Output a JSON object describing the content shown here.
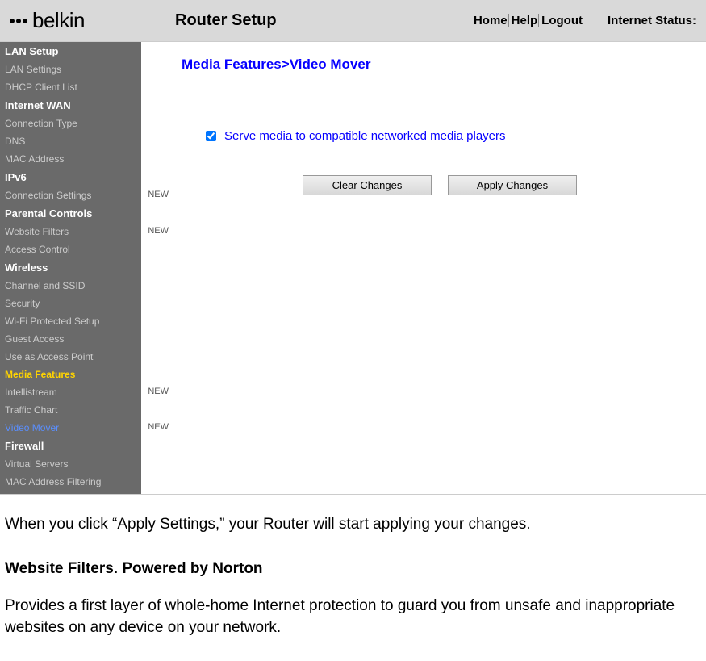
{
  "header": {
    "logo_text": "belkin",
    "title": "Router Setup",
    "links": {
      "home": "Home",
      "help": "Help",
      "logout": "Logout"
    },
    "internet_status_label": "Internet Status:"
  },
  "sidebar": {
    "items": [
      {
        "label": "LAN Setup",
        "type": "section"
      },
      {
        "label": "LAN Settings",
        "type": "sub"
      },
      {
        "label": "DHCP Client List",
        "type": "sub"
      },
      {
        "label": "Internet WAN",
        "type": "section"
      },
      {
        "label": "Connection Type",
        "type": "sub"
      },
      {
        "label": "DNS",
        "type": "sub"
      },
      {
        "label": "MAC Address",
        "type": "sub"
      },
      {
        "label": "IPv6",
        "type": "section"
      },
      {
        "label": "Connection Settings",
        "type": "sub",
        "new": "NEW"
      },
      {
        "label": "Parental Controls",
        "type": "section"
      },
      {
        "label": "Website Filters",
        "type": "sub",
        "new": "NEW"
      },
      {
        "label": "Access Control",
        "type": "sub"
      },
      {
        "label": "Wireless",
        "type": "section"
      },
      {
        "label": "Channel and SSID",
        "type": "sub"
      },
      {
        "label": "Security",
        "type": "sub"
      },
      {
        "label": "Wi-Fi Protected Setup",
        "type": "sub"
      },
      {
        "label": "Guest Access",
        "type": "sub"
      },
      {
        "label": "Use as Access Point",
        "type": "sub"
      },
      {
        "label": "Media Features",
        "type": "active-section"
      },
      {
        "label": "Intellistream",
        "type": "sub",
        "new": "NEW"
      },
      {
        "label": "Traffic Chart",
        "type": "sub"
      },
      {
        "label": "Video Mover",
        "type": "active-sub",
        "new": "NEW"
      },
      {
        "label": "Firewall",
        "type": "section"
      },
      {
        "label": "Virtual Servers",
        "type": "sub"
      },
      {
        "label": "MAC Address Filtering",
        "type": "sub"
      }
    ]
  },
  "content": {
    "breadcrumb": "Media Features>Video Mover",
    "checkbox_label": "Serve media to compatible networked media players",
    "checkbox_checked": true,
    "buttons": {
      "clear": "Clear Changes",
      "apply": "Apply Changes"
    }
  },
  "doc": {
    "p1": "When you click “Apply Settings,” your Router will start applying your changes.",
    "heading": "Website Filters. Powered by Norton",
    "p2": "Provides a first layer of whole-home Internet protection to guard you from unsafe and inappropriate websites on any device on your network."
  }
}
